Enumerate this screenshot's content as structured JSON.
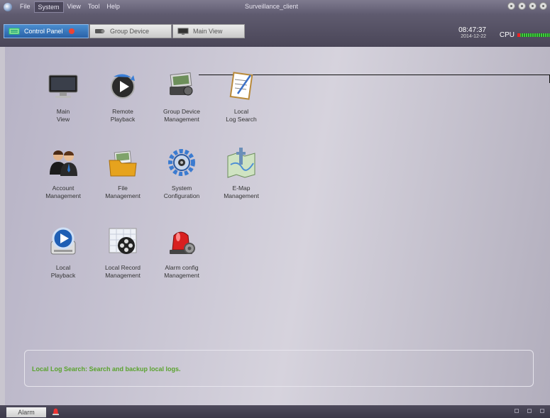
{
  "menu": {
    "items": [
      "File",
      "System",
      "View",
      "Tool",
      "Help"
    ],
    "active_item": "System"
  },
  "window_title": "Surveillance_client",
  "tabs": [
    {
      "label": "Control Panel",
      "active": true,
      "icon": "control-panel-icon"
    },
    {
      "label": "Group Device",
      "active": false,
      "icon": "group-device-icon"
    },
    {
      "label": "Main View",
      "active": false,
      "icon": "monitor-icon"
    }
  ],
  "clock": {
    "time": "08:47:37",
    "date": "2014-12-22"
  },
  "cpu": {
    "label": "CPU",
    "usage_level": 0.95
  },
  "grid": [
    {
      "label": "Main\nView",
      "icon": "monitor-icon"
    },
    {
      "label": "Remote\nPlayback",
      "icon": "remote-playback-icon"
    },
    {
      "label": "Group Device\nManagement",
      "icon": "group-device-icon"
    },
    {
      "label": "Local\nLog Search",
      "icon": "log-search-icon"
    },
    {
      "label": "Account\nManagement",
      "icon": "account-icon"
    },
    {
      "label": "File\nManagement",
      "icon": "folder-icon"
    },
    {
      "label": "System\nConfiguration",
      "icon": "gear-icon"
    },
    {
      "label": "E-Map\nManagement",
      "icon": "map-icon"
    },
    {
      "label": "Local\nPlayback",
      "icon": "local-playback-icon"
    },
    {
      "label": "Local Record\nManagement",
      "icon": "film-icon"
    },
    {
      "label": "Alarm config\nManagement",
      "icon": "alarm-icon"
    }
  ],
  "info_text": "Local Log Search: Search and backup local logs.",
  "status": {
    "alarm_label": "Alarm"
  },
  "colors": {
    "accent": "#2a62a8",
    "info_text": "#5aa32e",
    "alarm": "#e22"
  }
}
